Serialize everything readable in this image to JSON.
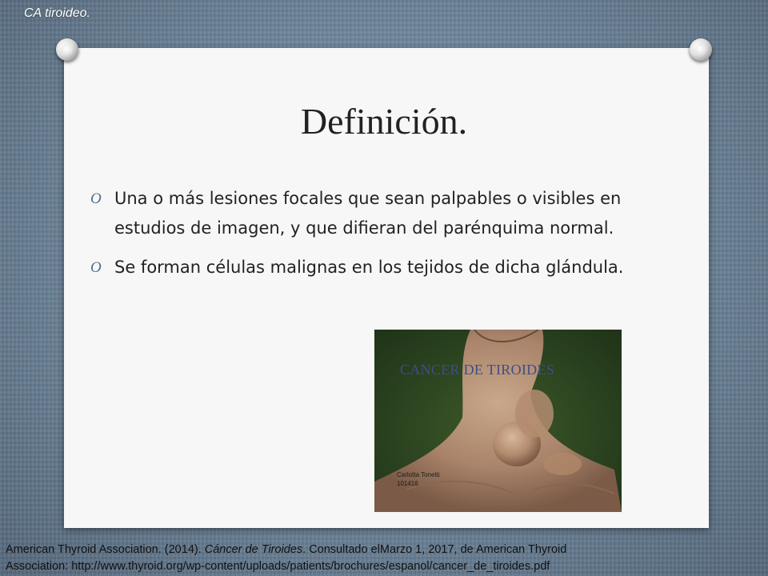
{
  "header": {
    "text": "CA tiroideo."
  },
  "slide": {
    "title": "Definición.",
    "bullet_marker": "O",
    "bullets": [
      "Una o más lesiones focales que sean palpables o visibles en estudios de imagen, y que difieran del parénquima normal.",
      "Se forman células malignas en los tejidos de dicha glándula."
    ]
  },
  "photo": {
    "caption": "CANCER DE TIROIDES",
    "credit_name": "Carlotta Tonetti",
    "credit_id": "101416"
  },
  "citation": {
    "line1_before": "American Thyroid Association. (2014). ",
    "line1_italic": "Cáncer de Tiroides",
    "line1_after": ". Consultado elMarzo 1, 2017, de American Thyroid",
    "line2": "Association: http://www.thyroid.org/wp-content/uploads/patients/brochures/espanol/cancer_de_tiroides.pdf"
  }
}
